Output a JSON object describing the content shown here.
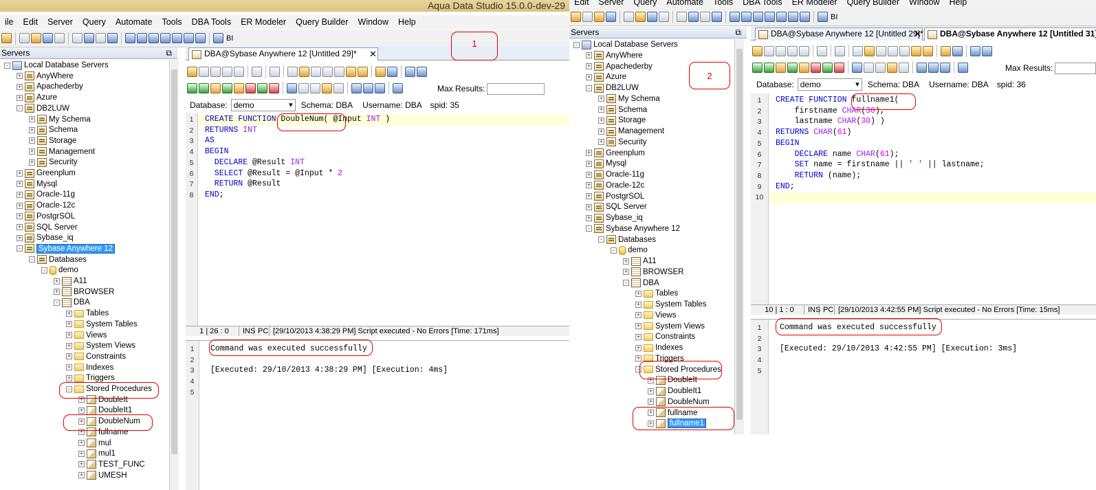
{
  "left": {
    "window_title": "Aqua Data Studio 15.0.0-dev-29",
    "menu": [
      "ile",
      "Edit",
      "Server",
      "Query",
      "Automate",
      "Tools",
      "DBA Tools",
      "ER Modeler",
      "Query Builder",
      "Window",
      "Help"
    ],
    "toolbar_bi": "BI",
    "tree_title": "Servers",
    "tree": [
      {
        "label": "Local Database Servers",
        "indent": 0,
        "pm": "-",
        "icon": "local"
      },
      {
        "label": "AnyWhere",
        "indent": 1,
        "pm": "+",
        "icon": "srv"
      },
      {
        "label": "Apachederby",
        "indent": 1,
        "pm": "+",
        "icon": "srv"
      },
      {
        "label": "Azure",
        "indent": 1,
        "pm": "+",
        "icon": "srv"
      },
      {
        "label": "DB2LUW",
        "indent": 1,
        "pm": "-",
        "icon": "srv"
      },
      {
        "label": "My Schema",
        "indent": 2,
        "pm": "+",
        "icon": "srv"
      },
      {
        "label": "Schema",
        "indent": 2,
        "pm": "+",
        "icon": "srv"
      },
      {
        "label": "Storage",
        "indent": 2,
        "pm": "+",
        "icon": "srv"
      },
      {
        "label": "Management",
        "indent": 2,
        "pm": "+",
        "icon": "srv"
      },
      {
        "label": "Security",
        "indent": 2,
        "pm": "+",
        "icon": "srv"
      },
      {
        "label": "Greenplum",
        "indent": 1,
        "pm": "+",
        "icon": "srv"
      },
      {
        "label": "Mysql",
        "indent": 1,
        "pm": "+",
        "icon": "srv"
      },
      {
        "label": "Oracle-11g",
        "indent": 1,
        "pm": "+",
        "icon": "srv"
      },
      {
        "label": "Oracle-12c",
        "indent": 1,
        "pm": "+",
        "icon": "srv"
      },
      {
        "label": "PostgrSOL",
        "indent": 1,
        "pm": "+",
        "icon": "srv"
      },
      {
        "label": "SQL Server",
        "indent": 1,
        "pm": "+",
        "icon": "srv"
      },
      {
        "label": "Sybase_iq",
        "indent": 1,
        "pm": "+",
        "icon": "srv"
      },
      {
        "label": "Sybase Anywhere 12",
        "indent": 1,
        "pm": "-",
        "icon": "srv",
        "selected": true
      },
      {
        "label": "Databases",
        "indent": 2,
        "pm": "-",
        "icon": "srv"
      },
      {
        "label": "demo",
        "indent": 3,
        "pm": "-",
        "icon": "db"
      },
      {
        "label": "A11",
        "indent": 4,
        "pm": "+",
        "icon": "tbl"
      },
      {
        "label": "BROWSER",
        "indent": 4,
        "pm": "+",
        "icon": "tbl"
      },
      {
        "label": "DBA",
        "indent": 4,
        "pm": "-",
        "icon": "tbl"
      },
      {
        "label": "Tables",
        "indent": 5,
        "pm": "+",
        "icon": "fold"
      },
      {
        "label": "System Tables",
        "indent": 5,
        "pm": "+",
        "icon": "fold"
      },
      {
        "label": "Views",
        "indent": 5,
        "pm": "+",
        "icon": "fold"
      },
      {
        "label": "System Views",
        "indent": 5,
        "pm": "+",
        "icon": "fold"
      },
      {
        "label": "Constraints",
        "indent": 5,
        "pm": "+",
        "icon": "fold"
      },
      {
        "label": "Indexes",
        "indent": 5,
        "pm": "+",
        "icon": "fold"
      },
      {
        "label": "Triggers",
        "indent": 5,
        "pm": "+",
        "icon": "fold"
      },
      {
        "label": "Stored Procedures",
        "indent": 5,
        "pm": "-",
        "icon": "fold"
      },
      {
        "label": "DoubleIt",
        "indent": 6,
        "pm": "+",
        "icon": "proc"
      },
      {
        "label": "DoubleIt1",
        "indent": 6,
        "pm": "+",
        "icon": "proc"
      },
      {
        "label": "DoubleNum",
        "indent": 6,
        "pm": "+",
        "icon": "proc"
      },
      {
        "label": "fullname",
        "indent": 6,
        "pm": "+",
        "icon": "proc"
      },
      {
        "label": "mul",
        "indent": 6,
        "pm": "+",
        "icon": "proc"
      },
      {
        "label": "mul1",
        "indent": 6,
        "pm": "+",
        "icon": "proc"
      },
      {
        "label": "TEST_FUNC",
        "indent": 6,
        "pm": "+",
        "icon": "proc"
      },
      {
        "label": "UMESH",
        "indent": 6,
        "pm": "+",
        "icon": "proc"
      }
    ],
    "tab_title": "DBA@Sybase Anywhere 12 [Untitled 29]*",
    "db_label": "Database:",
    "db_value": "demo",
    "schema": "Schema:  DBA",
    "username": "Username:  DBA",
    "spid": "spid:  35",
    "max_results": "Max Results:",
    "code_lines": [
      [
        [
          "CREATE FUNCTION ",
          "kw"
        ],
        [
          "DoubleNum( @Input ",
          ""
        ],
        [
          "INT",
          "ty"
        ],
        [
          " )",
          ""
        ]
      ],
      [
        [
          "RETURNS ",
          "kw"
        ],
        [
          "INT",
          "ty"
        ]
      ],
      [
        [
          "AS",
          "kw"
        ]
      ],
      [
        [
          "BEGIN",
          "kw"
        ]
      ],
      [
        [
          "  DECLARE ",
          "kw"
        ],
        [
          "@Result ",
          ""
        ],
        [
          "INT",
          "ty"
        ]
      ],
      [
        [
          "  SELECT ",
          "kw"
        ],
        [
          "@Result = @Input * ",
          ""
        ],
        [
          "2",
          "num"
        ]
      ],
      [
        [
          "  RETURN ",
          "kw"
        ],
        [
          "@Result",
          ""
        ]
      ],
      [
        [
          "END",
          "kw"
        ],
        [
          ";",
          ""
        ]
      ]
    ],
    "status": [
      "1 | 26 : 0",
      "INS",
      "PC",
      "[29/10/2013 4:38:29 PM] Script executed - No Errors [Time: 171ms]"
    ],
    "results": [
      "Command was executed successfully",
      "",
      "[Executed: 29/10/2013 4:38:29 PM] [Execution: 4ms]",
      "",
      ""
    ],
    "annotation": "1"
  },
  "right": {
    "menu": [
      "Edit",
      "Server",
      "Query",
      "Automate",
      "Tools",
      "DBA Tools",
      "ER Modeler",
      "Query Builder",
      "Window",
      "Help"
    ],
    "toolbar_bi": "BI",
    "tree_title": "Servers",
    "tree": [
      {
        "label": "Local Database Servers",
        "indent": 0,
        "pm": "-",
        "icon": "local"
      },
      {
        "label": "AnyWhere",
        "indent": 1,
        "pm": "+",
        "icon": "srv"
      },
      {
        "label": "Apachederby",
        "indent": 1,
        "pm": "+",
        "icon": "srv"
      },
      {
        "label": "Azure",
        "indent": 1,
        "pm": "+",
        "icon": "srv"
      },
      {
        "label": "DB2LUW",
        "indent": 1,
        "pm": "-",
        "icon": "srv"
      },
      {
        "label": "My Schema",
        "indent": 2,
        "pm": "+",
        "icon": "srv"
      },
      {
        "label": "Schema",
        "indent": 2,
        "pm": "+",
        "icon": "srv"
      },
      {
        "label": "Storage",
        "indent": 2,
        "pm": "+",
        "icon": "srv"
      },
      {
        "label": "Management",
        "indent": 2,
        "pm": "+",
        "icon": "srv"
      },
      {
        "label": "Security",
        "indent": 2,
        "pm": "+",
        "icon": "srv"
      },
      {
        "label": "Greenplum",
        "indent": 1,
        "pm": "+",
        "icon": "srv"
      },
      {
        "label": "Mysql",
        "indent": 1,
        "pm": "+",
        "icon": "srv"
      },
      {
        "label": "Oracle-11g",
        "indent": 1,
        "pm": "+",
        "icon": "srv"
      },
      {
        "label": "Oracle-12c",
        "indent": 1,
        "pm": "+",
        "icon": "srv"
      },
      {
        "label": "PostgrSOL",
        "indent": 1,
        "pm": "+",
        "icon": "srv"
      },
      {
        "label": "SQL Server",
        "indent": 1,
        "pm": "+",
        "icon": "srv"
      },
      {
        "label": "Sybase_iq",
        "indent": 1,
        "pm": "+",
        "icon": "srv"
      },
      {
        "label": "Sybase Anywhere 12",
        "indent": 1,
        "pm": "-",
        "icon": "srv"
      },
      {
        "label": "Databases",
        "indent": 2,
        "pm": "-",
        "icon": "srv"
      },
      {
        "label": "demo",
        "indent": 3,
        "pm": "-",
        "icon": "db"
      },
      {
        "label": "A11",
        "indent": 4,
        "pm": "+",
        "icon": "tbl"
      },
      {
        "label": "BROWSER",
        "indent": 4,
        "pm": "+",
        "icon": "tbl"
      },
      {
        "label": "DBA",
        "indent": 4,
        "pm": "-",
        "icon": "tbl"
      },
      {
        "label": "Tables",
        "indent": 5,
        "pm": "+",
        "icon": "fold"
      },
      {
        "label": "System Tables",
        "indent": 5,
        "pm": "+",
        "icon": "fold"
      },
      {
        "label": "Views",
        "indent": 5,
        "pm": "+",
        "icon": "fold"
      },
      {
        "label": "System Views",
        "indent": 5,
        "pm": "+",
        "icon": "fold"
      },
      {
        "label": "Constraints",
        "indent": 5,
        "pm": "+",
        "icon": "fold"
      },
      {
        "label": "Indexes",
        "indent": 5,
        "pm": "+",
        "icon": "fold"
      },
      {
        "label": "Triggers",
        "indent": 5,
        "pm": "+",
        "icon": "fold"
      },
      {
        "label": "Stored Procedures",
        "indent": 5,
        "pm": "-",
        "icon": "fold"
      },
      {
        "label": "DoubleIt",
        "indent": 6,
        "pm": "+",
        "icon": "proc"
      },
      {
        "label": "DoubleIt1",
        "indent": 6,
        "pm": "+",
        "icon": "proc"
      },
      {
        "label": "DoubleNum",
        "indent": 6,
        "pm": "+",
        "icon": "proc"
      },
      {
        "label": "fullname",
        "indent": 6,
        "pm": "+",
        "icon": "proc"
      },
      {
        "label": "fullname1",
        "indent": 6,
        "pm": "+",
        "icon": "proc",
        "selected": true
      }
    ],
    "tab1_title": "DBA@Sybase Anywhere 12 [Untitled 29]*",
    "tab2_title": "DBA@Sybase Anywhere 12 [Untitled 31]",
    "db_label": "Database:",
    "db_value": "demo",
    "schema": "Schema:  DBA",
    "username": "Username:  DBA",
    "spid": "spid:  36",
    "max_results": "Max Results:",
    "code_lines": [
      [
        [
          "CREATE FUNCTION ",
          "kw"
        ],
        [
          "fullname1(",
          ""
        ]
      ],
      [
        [
          "    firstname ",
          ""
        ],
        [
          "CHAR",
          "ty"
        ],
        [
          "(",
          ""
        ],
        [
          "30",
          "num"
        ],
        [
          "),",
          ""
        ]
      ],
      [
        [
          "    lastname ",
          ""
        ],
        [
          "CHAR",
          "ty"
        ],
        [
          "(",
          ""
        ],
        [
          "30",
          "num"
        ],
        [
          ") )",
          ""
        ]
      ],
      [
        [
          "RETURNS ",
          "kw"
        ],
        [
          "CHAR",
          "ty"
        ],
        [
          "(",
          ""
        ],
        [
          "61",
          "num"
        ],
        [
          ")",
          ""
        ]
      ],
      [
        [
          "BEGIN",
          "kw"
        ]
      ],
      [
        [
          "    DECLARE ",
          "kw"
        ],
        [
          "name ",
          ""
        ],
        [
          "CHAR",
          "ty"
        ],
        [
          "(",
          ""
        ],
        [
          "61",
          "num"
        ],
        [
          ");",
          ""
        ]
      ],
      [
        [
          "    SET ",
          "kw"
        ],
        [
          "name = firstname || ",
          ""
        ],
        [
          "' '",
          "str"
        ],
        [
          " || lastname;",
          ""
        ]
      ],
      [
        [
          "    RETURN ",
          "kw"
        ],
        [
          "(name);",
          ""
        ]
      ],
      [
        [
          "END",
          "kw"
        ],
        [
          ";",
          ""
        ]
      ],
      [
        [
          "",
          ""
        ]
      ]
    ],
    "status": [
      "10 | 1 : 0",
      "INS",
      "PC",
      "[29/10/2013 4:42:55 PM] Script executed - No Errors [Time: 15ms]"
    ],
    "results": [
      "Command was executed successfully",
      "",
      "[Executed: 29/10/2013 4:42:55 PM] [Execution: 3ms]",
      "",
      ""
    ],
    "annotation": "2"
  }
}
